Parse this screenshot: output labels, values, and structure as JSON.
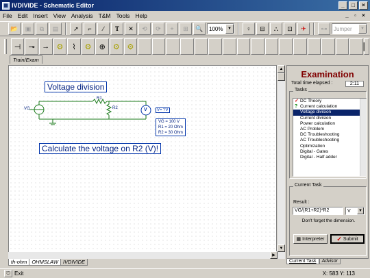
{
  "window": {
    "title": "IVDIVIDE - Schematic Editor",
    "app_icon": "app-icon"
  },
  "menu": [
    "File",
    "Edit",
    "Insert",
    "View",
    "Analysis",
    "T&M",
    "Tools",
    "Help"
  ],
  "toolbar": {
    "zoom": "100%",
    "analysis_combo": "Jumper"
  },
  "tab": {
    "label": "Train/Exam"
  },
  "schematic": {
    "title": "Voltage division",
    "r1": "R1",
    "r2": "R2",
    "vg": "VG",
    "meter_label": "V",
    "meter_value": "V= ?V",
    "params": [
      "VG = 100 V",
      "R1 = 20 Ohm",
      "R2 = 30 Ohm"
    ],
    "question": "Calculate the voltage on R2 (V)!"
  },
  "sheet_tabs": [
    "th-ohm",
    "OHMSLAW",
    "IVDIVIDE"
  ],
  "status": {
    "exit_label": "Exit",
    "coords": "X: 583 Y: 113"
  },
  "panel": {
    "title": "Examination",
    "elapsed_label": "Total time elapsed :",
    "elapsed_value": "2:11",
    "tasks_label": "Tasks",
    "tasks": [
      {
        "mark": "✓",
        "label": "DC Theory",
        "color": "#cc0000"
      },
      {
        "mark": "?",
        "label": "Current calculation",
        "color": "#008000"
      },
      {
        "mark": "",
        "label": "Voltage division",
        "selected": true
      },
      {
        "mark": "",
        "label": "Current division"
      },
      {
        "mark": "",
        "label": "Power calculation"
      },
      {
        "mark": "",
        "label": "AC Problem"
      },
      {
        "mark": "",
        "label": "DC Troubleshooting"
      },
      {
        "mark": "",
        "label": "AC Troubleshooting"
      },
      {
        "mark": "",
        "label": "Optimization"
      },
      {
        "mark": "",
        "label": "Digital - Gates"
      },
      {
        "mark": "",
        "label": "Digital - Half adder"
      }
    ],
    "current_task_label": "Current Task",
    "result_label": "Result :",
    "result_value": "VG/(R1+R2)*R2",
    "unit": "V",
    "hint": "Don't forget the dimension.",
    "interpreter_label": "Interpreter",
    "submit_label": "Submit",
    "tabs": [
      "Current Task",
      "Advisor"
    ]
  }
}
